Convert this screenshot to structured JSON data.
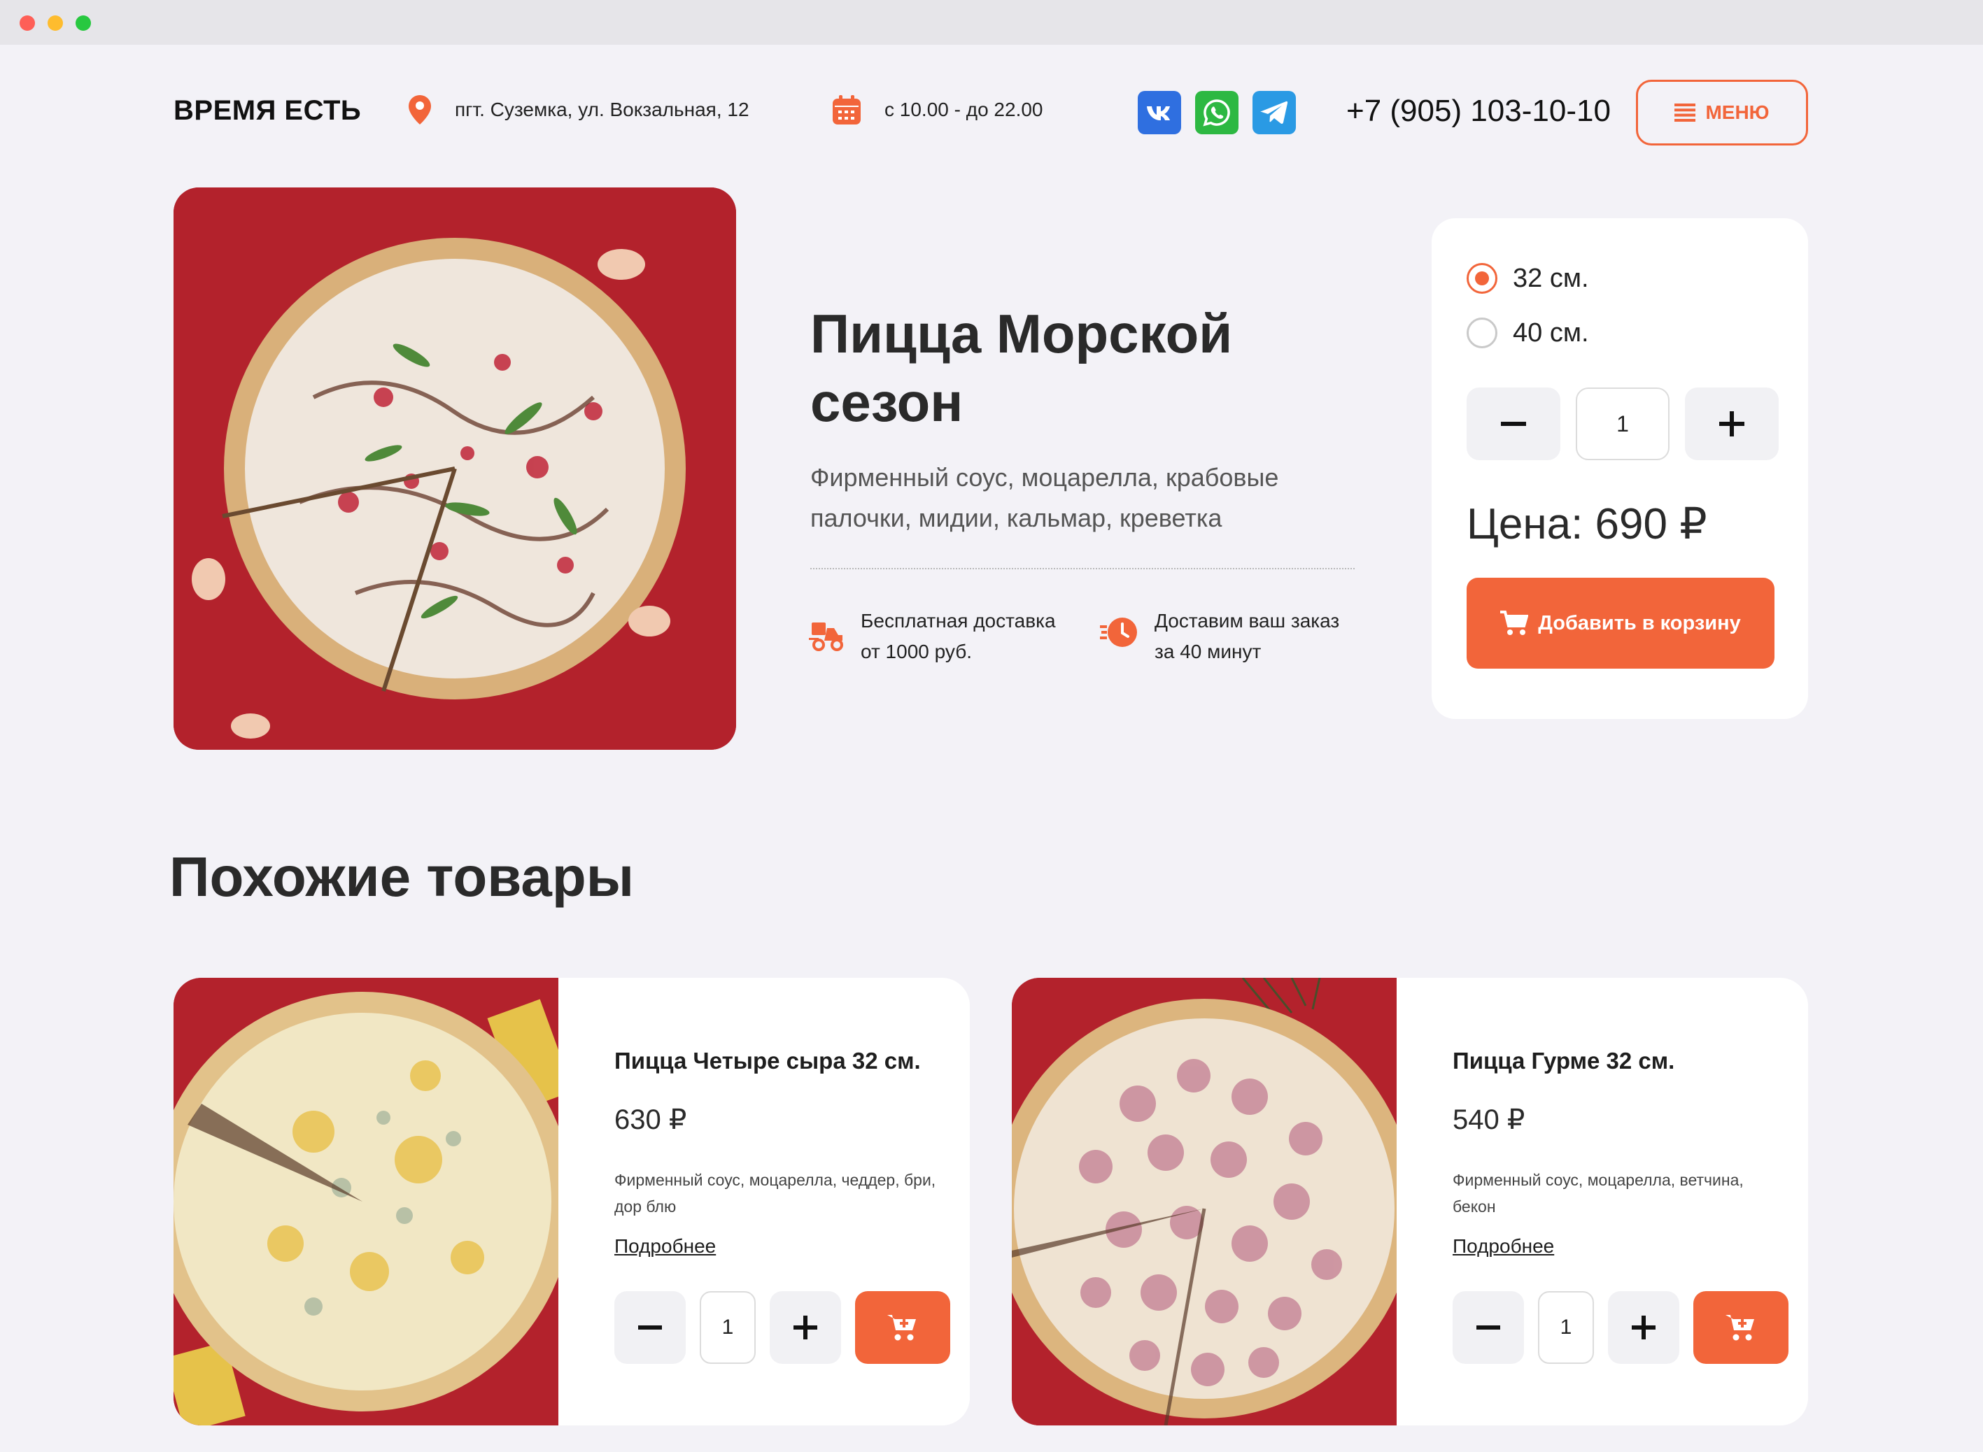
{
  "header": {
    "logo": "ВРЕМЯ ЕСТЬ",
    "address": "пгт. Суземка, ул. Вокзальная, 12",
    "hours": "с 10.00 - до 22.00",
    "socials": [
      "vk-icon",
      "whatsapp-icon",
      "telegram-icon"
    ],
    "phone": "+7 (905) 103-10-10",
    "menu_label": "МЕНЮ"
  },
  "product": {
    "title": "Пицца Морской сезон",
    "description": "Фирменный соус, моцарелла, крабовые палочки, мидии, кальмар, креветка",
    "features": [
      {
        "icon": "delivery-scooter-icon",
        "line1": "Бесплатная доставка",
        "line2": "от 1000 руб."
      },
      {
        "icon": "fast-clock-icon",
        "line1": "Доставим ваш заказ",
        "line2": "за 40 минут"
      }
    ],
    "sizes": [
      {
        "label": "32 см.",
        "selected": true
      },
      {
        "label": "40 см.",
        "selected": false
      }
    ],
    "quantity": "1",
    "price": "Цена: 690 ₽",
    "add_to_cart": "Добавить в корзину"
  },
  "similar": {
    "title": "Похожие товары",
    "items": [
      {
        "name": "Пицца Четыре сыра 32 см.",
        "price": "630 ₽",
        "description": "Фирменный соус, моцарелла, чеддер, бри, дор блю",
        "link": "Подробнее",
        "quantity": "1"
      },
      {
        "name": "Пицца Гурме 32 см.",
        "price": "540 ₽",
        "description": "Фирменный соус, моцарелла, ветчина, бекон",
        "link": "Подробнее",
        "quantity": "1"
      }
    ]
  },
  "colors": {
    "accent": "#f2653a",
    "background": "#f3f2f7",
    "image_background": "#b3222c"
  }
}
